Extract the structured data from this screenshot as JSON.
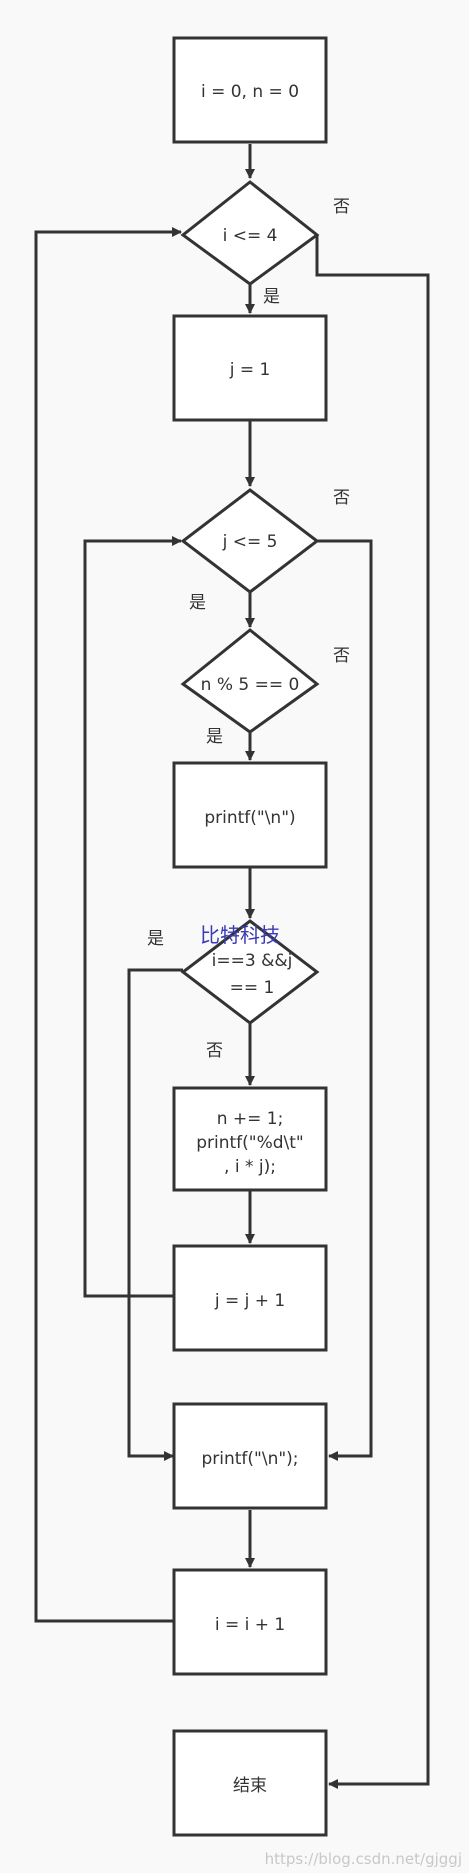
{
  "nodes": {
    "init": "i = 0, n = 0",
    "outer_cond": "i <= 4",
    "set_j": "j = 1",
    "inner_cond": "j <= 5",
    "mod_cond": "n % 5 == 0",
    "print_newline": "printf(\"\\n\")",
    "skip_cond": [
      "i==3 &&j",
      "== 1"
    ],
    "body": [
      "n += 1;",
      "printf(\"%d\\t\"",
      ", i * j);"
    ],
    "inc_j": "j = j + 1",
    "print_newline_end": "printf(\"\\n\");",
    "inc_i": "i = i + 1",
    "end": "结束"
  },
  "edge_labels": {
    "yes": "是",
    "no": "否"
  },
  "watermark": "比特科技",
  "footer_url": "https://blog.csdn.net/gjggj"
}
